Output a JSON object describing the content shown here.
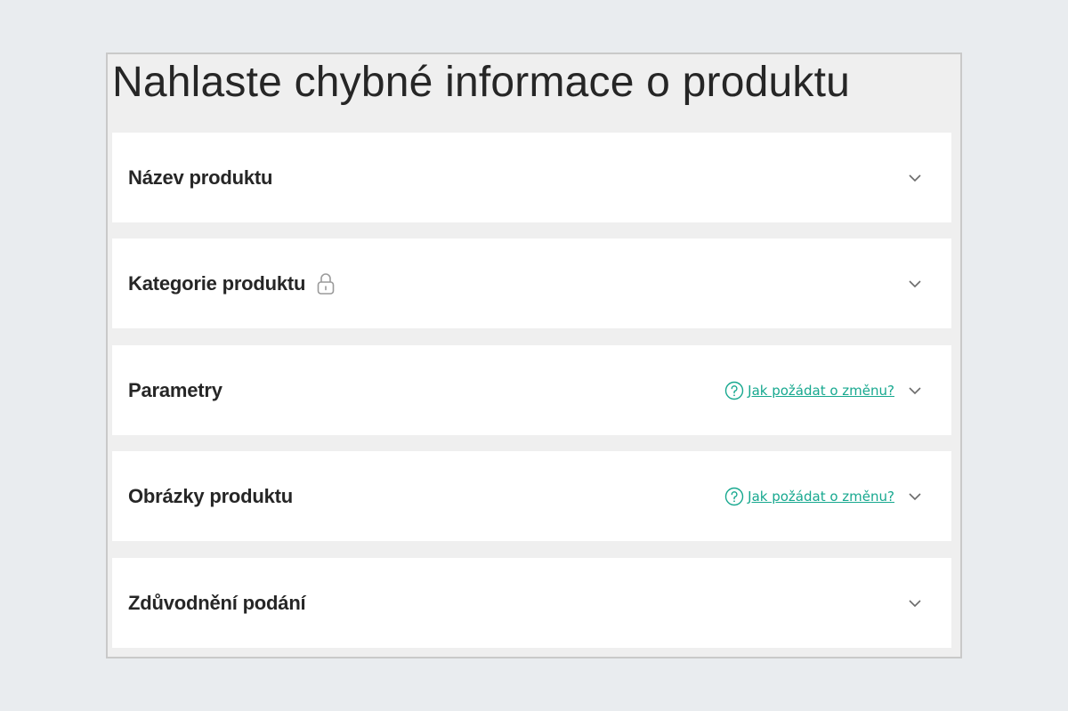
{
  "page": {
    "title": "Nahlaste chybné informace o produktu"
  },
  "sections": [
    {
      "label": "Název produktu",
      "locked": false,
      "help": ""
    },
    {
      "label": "Kategorie produktu",
      "locked": true,
      "help": ""
    },
    {
      "label": "Parametry",
      "locked": false,
      "help": "Jak požádat o změnu?"
    },
    {
      "label": "Obrázky produktu",
      "locked": false,
      "help": "Jak požádat o změnu?"
    },
    {
      "label": "Zdůvodnění podání",
      "locked": false,
      "help": ""
    }
  ],
  "icons": {
    "chevron": "chevron-down-icon",
    "lock": "lock-icon",
    "help": "question-circle-icon"
  },
  "colors": {
    "accent": "#17a88f",
    "page_bg": "#e9ecef",
    "panel_bg": "#efefef",
    "card_bg": "#ffffff",
    "text": "#262626",
    "muted": "#9a9a9a"
  }
}
